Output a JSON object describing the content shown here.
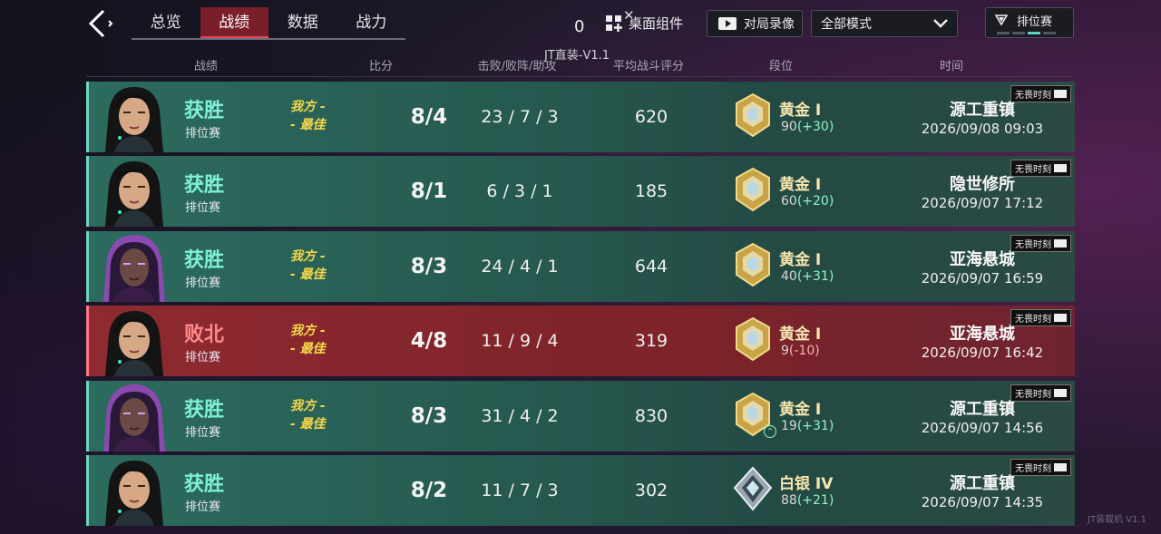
{
  "nav": {
    "tabs": [
      {
        "label": "总览",
        "active": false
      },
      {
        "label": "战绩",
        "active": true
      },
      {
        "label": "数据",
        "active": false
      },
      {
        "label": "战力",
        "active": false
      }
    ]
  },
  "overlay": {
    "counter": "0",
    "watermark": "JT直装-V1.1",
    "widget_label": "桌面组件"
  },
  "controls": {
    "replay_label": "对局录像",
    "mode_select": "全部模式",
    "rank_filter": "排位赛"
  },
  "columns": {
    "record": "战绩",
    "score": "比分",
    "kda": "击败/败阵/助攻",
    "rating": "平均战斗评分",
    "rank": "段位",
    "time": "时间"
  },
  "mvp_line1": "我方 -",
  "mvp_line2": "- 最佳",
  "fearless_tag": "无畏时刻",
  "matches": [
    {
      "result": "获胜",
      "outcome": "win",
      "mode": "排位赛",
      "mvp": true,
      "score": "8/4",
      "kda": "23 / 7 / 3",
      "rating": "620",
      "tier": "黄金 I",
      "rp": "90",
      "rp_delta": "(+30)",
      "map": "源工重镇",
      "datetime": "2026/09/08 09:03",
      "portrait": "portrait-a",
      "badge": "gold"
    },
    {
      "result": "获胜",
      "outcome": "win",
      "mode": "排位赛",
      "mvp": false,
      "score": "8/1",
      "kda": "6 / 3 / 1",
      "rating": "185",
      "tier": "黄金 I",
      "rp": "60",
      "rp_delta": "(+20)",
      "map": "隐世修所",
      "datetime": "2026/09/07 17:12",
      "portrait": "portrait-a",
      "badge": "gold"
    },
    {
      "result": "获胜",
      "outcome": "win",
      "mode": "排位赛",
      "mvp": true,
      "score": "8/3",
      "kda": "24 / 4 / 1",
      "rating": "644",
      "tier": "黄金 I",
      "rp": "40",
      "rp_delta": "(+31)",
      "map": "亚海悬城",
      "datetime": "2026/09/07 16:59",
      "portrait": "portrait-b",
      "badge": "gold"
    },
    {
      "result": "败北",
      "outcome": "loss",
      "mode": "排位赛",
      "mvp": true,
      "score": "4/8",
      "kda": "11 / 9 / 4",
      "rating": "319",
      "tier": "黄金 I",
      "rp": "9",
      "rp_delta": "(-10)",
      "map": "亚海悬城",
      "datetime": "2026/09/07 16:42",
      "portrait": "portrait-a",
      "badge": "gold"
    },
    {
      "result": "获胜",
      "outcome": "win",
      "mode": "排位赛",
      "mvp": true,
      "score": "8/3",
      "kda": "31 / 4 / 2",
      "rating": "830",
      "tier": "黄金 I",
      "rp": "19",
      "rp_delta": "(+31)",
      "map": "源工重镇",
      "datetime": "2026/09/07 14:56",
      "portrait": "portrait-b",
      "badge": "gold",
      "promoted": true
    },
    {
      "result": "获胜",
      "outcome": "win",
      "mode": "排位赛",
      "mvp": false,
      "score": "8/2",
      "kda": "11 / 7 / 3",
      "rating": "302",
      "tier": "白银 IV",
      "rp": "88",
      "rp_delta": "(+21)",
      "map": "源工重镇",
      "datetime": "2026/09/07 14:35",
      "portrait": "portrait-a",
      "badge": "silver"
    }
  ],
  "version_tag": "JT装载机 V1.1"
}
